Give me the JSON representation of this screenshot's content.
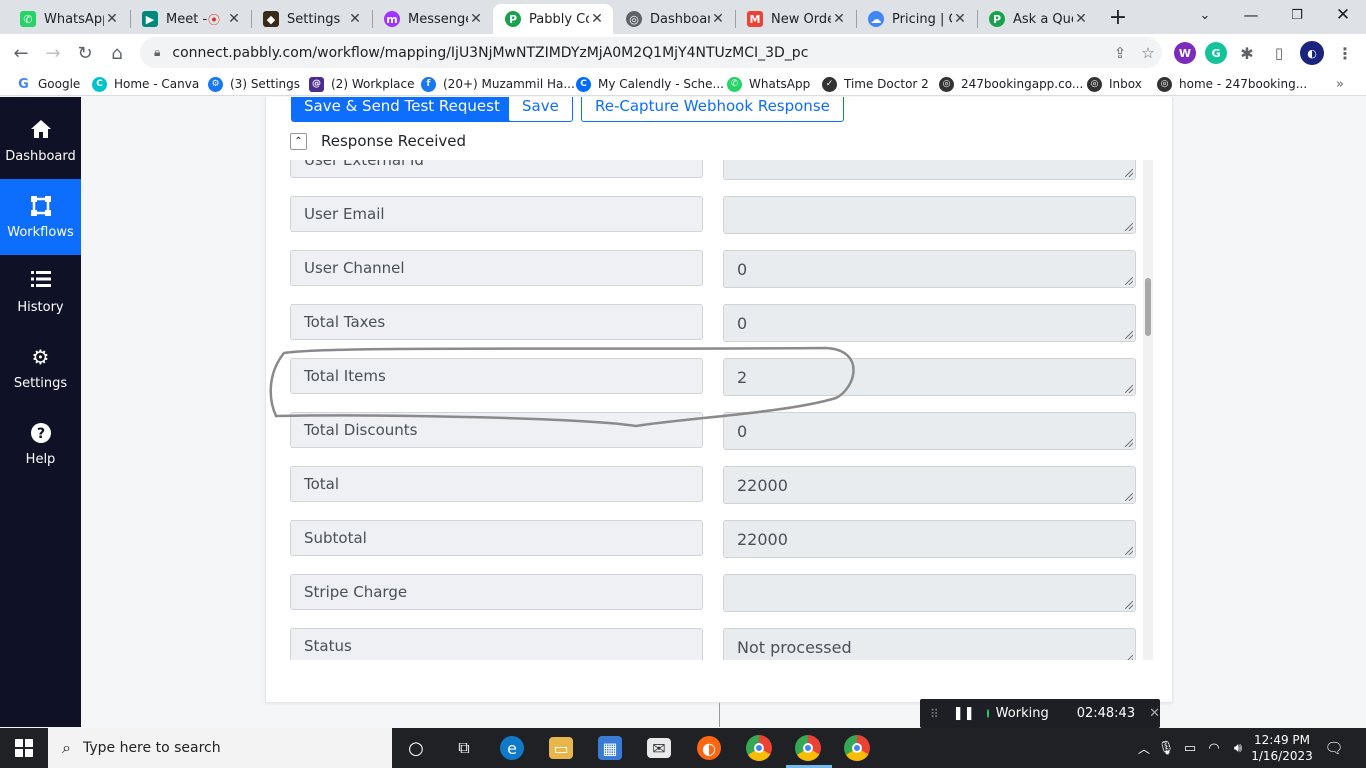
{
  "browser": {
    "tabs": [
      {
        "label": "WhatsApp",
        "icon": "whatsapp-icon",
        "color": "#25d366"
      },
      {
        "label": "Meet - ",
        "icon": "google-meet-icon",
        "color": "#00897b"
      },
      {
        "label": "Settings",
        "icon": "settings-app-icon",
        "color": "#3b2a1a"
      },
      {
        "label": "Messenger",
        "icon": "messenger-icon",
        "color": "#a033ff"
      },
      {
        "label": "Pabbly Co",
        "icon": "pabbly-icon",
        "color": "#16a34a",
        "active": true
      },
      {
        "label": "Dashboard",
        "icon": "globe-icon",
        "color": "#5f6368"
      },
      {
        "label": "New Orde",
        "icon": "gmail-icon",
        "color": "#ea4335"
      },
      {
        "label": "Pricing | C",
        "icon": "cloud-icon",
        "color": "#4285f4"
      },
      {
        "label": "Ask a Que",
        "icon": "pabbly-icon",
        "color": "#16a34a"
      }
    ],
    "url": "connect.pabbly.com/workflow/mapping/IjU3NjMwNTZIMDYzMjA0M2Q1MjY4NTUzMCI_3D_pc",
    "bookmarks": [
      {
        "label": "Google",
        "icon": "google-icon",
        "color": "#4285f4"
      },
      {
        "label": "Home - Canva",
        "icon": "canva-icon",
        "color": "#00c4cc"
      },
      {
        "label": "(3) Settings",
        "icon": "settings-icon",
        "color": "#1877f2"
      },
      {
        "label": "(2) Workplace",
        "icon": "workplace-icon",
        "color": "#4b2d91"
      },
      {
        "label": "(20+) Muzammil Ha...",
        "icon": "facebook-icon",
        "color": "#1877f2"
      },
      {
        "label": "My Calendly - Sche...",
        "icon": "calendly-icon",
        "color": "#006bff"
      },
      {
        "label": "WhatsApp",
        "icon": "whatsapp-icon",
        "color": "#25d366"
      },
      {
        "label": "Time Doctor 2",
        "icon": "timedoctor-icon",
        "color": "#333333"
      },
      {
        "label": "247bookingapp.co...",
        "icon": "globe-icon",
        "color": "#333333"
      },
      {
        "label": "Inbox",
        "icon": "globe-icon",
        "color": "#333333"
      },
      {
        "label": "home - 247booking...",
        "icon": "globe-icon",
        "color": "#333333"
      }
    ]
  },
  "sidebar": {
    "items": [
      {
        "label": "Dashboard",
        "icon": "home-icon"
      },
      {
        "label": "Workflows",
        "icon": "workflows-icon",
        "active": true
      },
      {
        "label": "History",
        "icon": "history-icon"
      },
      {
        "label": "Settings",
        "icon": "gear-icon"
      },
      {
        "label": "Help",
        "icon": "help-icon"
      }
    ]
  },
  "actions": {
    "save_send": "Save & Send Test Request",
    "save": "Save",
    "recapture": "Re-Capture Webhook Response"
  },
  "response": {
    "title": "Response Received",
    "rows": [
      {
        "label": "User External Id",
        "value": ""
      },
      {
        "label": "User Email",
        "value": ""
      },
      {
        "label": "User Channel",
        "value": "0"
      },
      {
        "label": "Total Taxes",
        "value": "0"
      },
      {
        "label": "Total Items",
        "value": "2"
      },
      {
        "label": "Total Discounts",
        "value": "0"
      },
      {
        "label": "Total",
        "value": "22000"
      },
      {
        "label": "Subtotal",
        "value": "22000"
      },
      {
        "label": "Stripe Charge",
        "value": ""
      },
      {
        "label": "Status",
        "value": "Not processed"
      }
    ]
  },
  "timer": {
    "status": "Working",
    "time": "02:48:43"
  },
  "taskbar": {
    "search_placeholder": "Type here to search",
    "time": "12:49 PM",
    "date": "1/16/2023"
  },
  "colors": {
    "primary": "#0d6efd",
    "sidebar_bg": "#0f1226"
  }
}
